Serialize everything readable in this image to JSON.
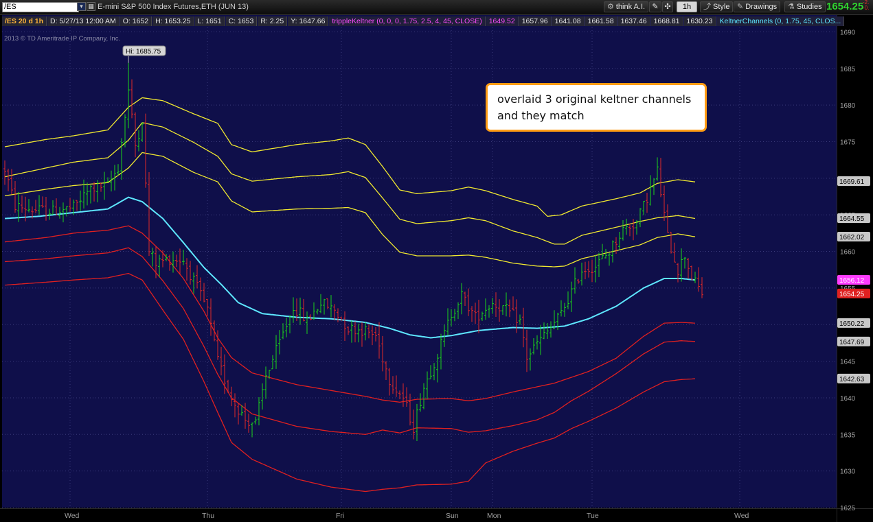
{
  "toolbar": {
    "symbol": "/ES",
    "description": "E-mini S&P 500 Index Futures,ETH (JUN 13)",
    "think_ai_label": "think A.I.",
    "aggregation_label": "1h",
    "style_label": "Style",
    "drawings_label": "Drawings",
    "studies_label": "Studies",
    "last_price": "1654.25",
    "change_top": "-2.",
    "change_bottom": "-0.",
    "colors": {
      "price_up": "#2fd42f",
      "change_down": "#e03030"
    }
  },
  "status_bar": {
    "symbol_period": "/ES 20 d 1h",
    "date": "D: 5/27/13 12:00 AM",
    "open": "O: 1652",
    "high": "H: 1653.25",
    "low": "L: 1651",
    "close": "C: 1653",
    "range": "R: 2.25",
    "y": "Y: 1647.66",
    "tripple_keltner": "trippleKeltner (0, 0, 0, 1.75, 2.5, 4, 45, CLOSE)",
    "tk_values": [
      "1649.52",
      "1657.96",
      "1641.08",
      "1661.58",
      "1637.46",
      "1668.81",
      "1630.23"
    ],
    "keltner_channels": "KeltnerChannels (0, 1.75, 45, CLOS..."
  },
  "copyright": "2013 © TD Ameritrade IP Company, Inc.",
  "annotation": {
    "line1": "overlaid 3 original keltner channels",
    "line2": "and they match"
  },
  "chart_data": {
    "type": "candlestick",
    "ylim": [
      1625,
      1691
    ],
    "y_ticks": [
      1625,
      1630,
      1635,
      1640,
      1645,
      1650,
      1655,
      1660,
      1665,
      1670,
      1675,
      1680,
      1685,
      1690
    ],
    "x_labels": [
      "Wed",
      "Thu",
      "Fri",
      "Sun",
      "Mon",
      "Tue",
      "Wed"
    ],
    "x_label_bars": [
      19,
      59,
      98,
      130,
      142,
      171,
      214
    ],
    "n_bars": 204,
    "hi_label": "Hi: 1685.75",
    "hi_value": 1685.75,
    "hi_bar": 36,
    "price_labels": [
      {
        "value": 1669.61,
        "text": "1669.61",
        "bg": "#c8c8c8",
        "fg": "#000000"
      },
      {
        "value": 1664.55,
        "text": "1664.55",
        "bg": "#c8c8c8",
        "fg": "#000000"
      },
      {
        "value": 1662.02,
        "text": "1662.02",
        "bg": "#c8c8c8",
        "fg": "#000000"
      },
      {
        "value": 1656.12,
        "text": "1656.12",
        "bg": "#ff3cff",
        "fg": "#ffffff"
      },
      {
        "value": 1654.25,
        "text": "1654.25",
        "bg": "#e02020",
        "fg": "#ffffff"
      },
      {
        "value": 1650.22,
        "text": "1650.22",
        "bg": "#c8c8c8",
        "fg": "#000000"
      },
      {
        "value": 1647.69,
        "text": "1647.69",
        "bg": "#c8c8c8",
        "fg": "#000000"
      },
      {
        "value": 1642.63,
        "text": "1642.63",
        "bg": "#c8c8c8",
        "fg": "#000000"
      }
    ],
    "colors": {
      "background": "#0f0f4a",
      "grid": "#3a3a7a",
      "up": "#1bd41b",
      "down": "#e02828",
      "upper_bands": "#f0e830",
      "lower_bands": "#e02020",
      "midline": "#5ee7ff"
    },
    "midline": [
      [
        0,
        1664.5
      ],
      [
        10,
        1664.8
      ],
      [
        20,
        1665.3
      ],
      [
        30,
        1665.8
      ],
      [
        36,
        1667.4
      ],
      [
        40,
        1666.8
      ],
      [
        46,
        1664.5
      ],
      [
        52,
        1661.2
      ],
      [
        58,
        1657.8
      ],
      [
        63,
        1655.5
      ],
      [
        68,
        1653.0
      ],
      [
        75,
        1651.5
      ],
      [
        85,
        1651.0
      ],
      [
        95,
        1650.8
      ],
      [
        105,
        1650.3
      ],
      [
        112,
        1649.5
      ],
      [
        118,
        1648.6
      ],
      [
        124,
        1648.2
      ],
      [
        130,
        1648.5
      ],
      [
        138,
        1649.2
      ],
      [
        148,
        1649.6
      ],
      [
        155,
        1649.5
      ],
      [
        163,
        1649.8
      ],
      [
        170,
        1650.8
      ],
      [
        178,
        1652.5
      ],
      [
        186,
        1655.0
      ],
      [
        192,
        1656.3
      ],
      [
        197,
        1656.3
      ],
      [
        201,
        1656.1
      ]
    ],
    "upper_bands": [
      [
        [
          0,
          1674.3
        ],
        [
          12,
          1675.3
        ],
        [
          20,
          1675.8
        ],
        [
          30,
          1676.6
        ],
        [
          36,
          1679.7
        ],
        [
          40,
          1681.0
        ],
        [
          46,
          1680.6
        ],
        [
          55,
          1678.8
        ],
        [
          62,
          1677.5
        ],
        [
          66,
          1674.6
        ],
        [
          72,
          1673.6
        ],
        [
          85,
          1674.6
        ],
        [
          95,
          1675.1
        ],
        [
          100,
          1675.5
        ],
        [
          105,
          1674.6
        ],
        [
          110,
          1671.6
        ],
        [
          115,
          1668.4
        ],
        [
          120,
          1667.9
        ],
        [
          130,
          1668.3
        ],
        [
          135,
          1668.8
        ],
        [
          140,
          1668.3
        ],
        [
          148,
          1667.1
        ],
        [
          155,
          1666.2
        ],
        [
          158,
          1664.8
        ],
        [
          162,
          1665.0
        ],
        [
          168,
          1666.2
        ],
        [
          178,
          1667.2
        ],
        [
          185,
          1668.0
        ],
        [
          190,
          1669.3
        ],
        [
          196,
          1669.8
        ],
        [
          201,
          1669.5
        ]
      ],
      [
        [
          0,
          1670.2
        ],
        [
          12,
          1671.4
        ],
        [
          20,
          1672.2
        ],
        [
          30,
          1672.8
        ],
        [
          36,
          1675.2
        ],
        [
          40,
          1677.6
        ],
        [
          46,
          1677.0
        ],
        [
          55,
          1674.9
        ],
        [
          62,
          1673.0
        ],
        [
          66,
          1670.6
        ],
        [
          72,
          1669.6
        ],
        [
          85,
          1670.2
        ],
        [
          95,
          1670.5
        ],
        [
          100,
          1670.9
        ],
        [
          105,
          1670.1
        ],
        [
          110,
          1667.3
        ],
        [
          115,
          1664.4
        ],
        [
          120,
          1663.8
        ],
        [
          130,
          1664.2
        ],
        [
          135,
          1664.6
        ],
        [
          140,
          1664.2
        ],
        [
          148,
          1662.8
        ],
        [
          155,
          1661.9
        ],
        [
          160,
          1661.0
        ],
        [
          163,
          1661.0
        ],
        [
          168,
          1662.2
        ],
        [
          178,
          1663.3
        ],
        [
          185,
          1664.1
        ],
        [
          190,
          1664.6
        ],
        [
          196,
          1664.9
        ],
        [
          201,
          1664.5
        ]
      ],
      [
        [
          0,
          1667.6
        ],
        [
          12,
          1668.5
        ],
        [
          20,
          1669.0
        ],
        [
          30,
          1669.4
        ],
        [
          36,
          1671.4
        ],
        [
          40,
          1673.5
        ],
        [
          46,
          1673.0
        ],
        [
          55,
          1670.8
        ],
        [
          62,
          1669.5
        ],
        [
          66,
          1666.9
        ],
        [
          72,
          1665.4
        ],
        [
          85,
          1665.8
        ],
        [
          95,
          1665.9
        ],
        [
          100,
          1666.0
        ],
        [
          105,
          1665.3
        ],
        [
          110,
          1662.3
        ],
        [
          115,
          1659.9
        ],
        [
          120,
          1659.4
        ],
        [
          130,
          1659.4
        ],
        [
          135,
          1659.5
        ],
        [
          140,
          1659.2
        ],
        [
          148,
          1658.4
        ],
        [
          155,
          1658.0
        ],
        [
          160,
          1657.9
        ],
        [
          163,
          1658.0
        ],
        [
          168,
          1659.0
        ],
        [
          178,
          1660.1
        ],
        [
          185,
          1660.9
        ],
        [
          190,
          1661.9
        ],
        [
          196,
          1662.4
        ],
        [
          201,
          1662.0
        ]
      ]
    ],
    "lower_bands": [
      [
        [
          0,
          1661.3
        ],
        [
          12,
          1661.9
        ],
        [
          20,
          1662.5
        ],
        [
          30,
          1662.9
        ],
        [
          36,
          1663.5
        ],
        [
          40,
          1662.5
        ],
        [
          46,
          1659.8
        ],
        [
          52,
          1656.3
        ],
        [
          58,
          1651.8
        ],
        [
          62,
          1648.2
        ],
        [
          66,
          1645.5
        ],
        [
          72,
          1643.4
        ],
        [
          85,
          1641.8
        ],
        [
          95,
          1641.0
        ],
        [
          105,
          1640.2
        ],
        [
          110,
          1639.7
        ],
        [
          115,
          1639.4
        ],
        [
          120,
          1639.8
        ],
        [
          130,
          1639.9
        ],
        [
          135,
          1639.6
        ],
        [
          140,
          1639.9
        ],
        [
          148,
          1640.8
        ],
        [
          155,
          1641.5
        ],
        [
          160,
          1642.0
        ],
        [
          165,
          1642.8
        ],
        [
          170,
          1643.6
        ],
        [
          178,
          1645.4
        ],
        [
          186,
          1648.4
        ],
        [
          192,
          1650.2
        ],
        [
          197,
          1650.3
        ],
        [
          201,
          1650.2
        ]
      ],
      [
        [
          0,
          1658.6
        ],
        [
          12,
          1659.0
        ],
        [
          20,
          1659.4
        ],
        [
          30,
          1659.8
        ],
        [
          36,
          1660.5
        ],
        [
          40,
          1659.3
        ],
        [
          46,
          1656.0
        ],
        [
          52,
          1652.2
        ],
        [
          58,
          1647.0
        ],
        [
          62,
          1643.2
        ],
        [
          66,
          1640.0
        ],
        [
          72,
          1637.8
        ],
        [
          85,
          1636.1
        ],
        [
          95,
          1635.4
        ],
        [
          105,
          1635.0
        ],
        [
          110,
          1635.6
        ],
        [
          115,
          1635.2
        ],
        [
          120,
          1635.9
        ],
        [
          130,
          1635.8
        ],
        [
          135,
          1635.3
        ],
        [
          140,
          1635.5
        ],
        [
          148,
          1636.2
        ],
        [
          155,
          1637.0
        ],
        [
          160,
          1638.0
        ],
        [
          165,
          1639.6
        ],
        [
          170,
          1640.9
        ],
        [
          178,
          1643.3
        ],
        [
          186,
          1646.0
        ],
        [
          192,
          1647.6
        ],
        [
          197,
          1647.8
        ],
        [
          201,
          1647.7
        ]
      ],
      [
        [
          0,
          1655.4
        ],
        [
          12,
          1655.8
        ],
        [
          20,
          1656.1
        ],
        [
          30,
          1656.4
        ],
        [
          36,
          1657.0
        ],
        [
          40,
          1656.1
        ],
        [
          46,
          1652.0
        ],
        [
          52,
          1648.0
        ],
        [
          58,
          1642.2
        ],
        [
          62,
          1638.0
        ],
        [
          66,
          1633.9
        ],
        [
          72,
          1631.6
        ],
        [
          85,
          1628.9
        ],
        [
          95,
          1627.8
        ],
        [
          105,
          1627.2
        ],
        [
          110,
          1627.5
        ],
        [
          115,
          1627.7
        ],
        [
          120,
          1628.1
        ],
        [
          130,
          1628.2
        ],
        [
          135,
          1628.6
        ],
        [
          140,
          1631.1
        ],
        [
          148,
          1632.7
        ],
        [
          155,
          1633.8
        ],
        [
          160,
          1634.5
        ],
        [
          165,
          1635.8
        ],
        [
          170,
          1636.8
        ],
        [
          178,
          1638.6
        ],
        [
          186,
          1640.8
        ],
        [
          192,
          1642.2
        ],
        [
          197,
          1642.5
        ],
        [
          201,
          1642.6
        ]
      ]
    ],
    "price_path": [
      [
        0,
        1671.2
      ],
      [
        3,
        1666.2
      ],
      [
        8,
        1665.7
      ],
      [
        14,
        1665.5
      ],
      [
        20,
        1666.0
      ],
      [
        25,
        1668.6
      ],
      [
        30,
        1669.0
      ],
      [
        33,
        1671.5
      ],
      [
        36,
        1682.0
      ],
      [
        38,
        1674.5
      ],
      [
        40,
        1678.0
      ],
      [
        42,
        1660.0
      ],
      [
        44,
        1658.5
      ],
      [
        48,
        1659.0
      ],
      [
        52,
        1658.8
      ],
      [
        56,
        1655.0
      ],
      [
        59,
        1652.0
      ],
      [
        62,
        1645.0
      ],
      [
        66,
        1640.0
      ],
      [
        70,
        1637.0
      ],
      [
        73,
        1636.5
      ],
      [
        76,
        1643.0
      ],
      [
        80,
        1647.5
      ],
      [
        84,
        1652.5
      ],
      [
        88,
        1650.5
      ],
      [
        92,
        1653.0
      ],
      [
        96,
        1652.0
      ],
      [
        100,
        1649.5
      ],
      [
        104,
        1649.3
      ],
      [
        108,
        1648.5
      ],
      [
        112,
        1642.5
      ],
      [
        116,
        1640.0
      ],
      [
        119,
        1636.0
      ],
      [
        122,
        1641.5
      ],
      [
        126,
        1646.0
      ],
      [
        130,
        1651.5
      ],
      [
        133,
        1654.0
      ],
      [
        137,
        1651.0
      ],
      [
        142,
        1653.0
      ],
      [
        146,
        1652.0
      ],
      [
        150,
        1650.5
      ],
      [
        152,
        1645.5
      ],
      [
        155,
        1647.5
      ],
      [
        158,
        1649.0
      ],
      [
        162,
        1651.5
      ],
      [
        165,
        1654.5
      ],
      [
        168,
        1657.5
      ],
      [
        172,
        1658.0
      ],
      [
        176,
        1660.0
      ],
      [
        180,
        1663.0
      ],
      [
        184,
        1664.0
      ],
      [
        188,
        1668.5
      ],
      [
        190,
        1671.0
      ],
      [
        193,
        1662.0
      ],
      [
        196,
        1657.5
      ],
      [
        198,
        1659.5
      ],
      [
        200,
        1656.5
      ],
      [
        203,
        1654.25
      ]
    ]
  }
}
